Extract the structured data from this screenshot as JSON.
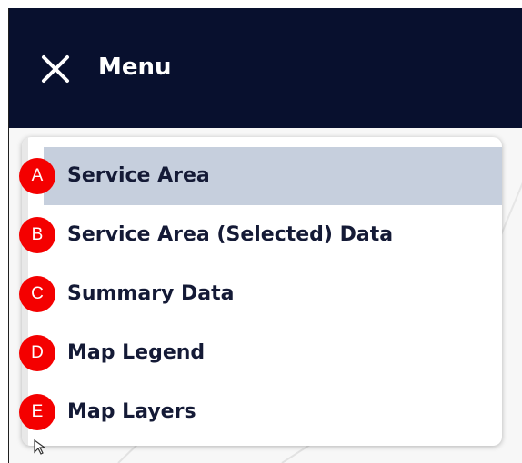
{
  "header": {
    "title": "Menu",
    "close_icon": "close-x-icon",
    "background_color": "#08102e"
  },
  "menu": {
    "items": [
      {
        "label": "Service Area",
        "badge": "A",
        "selected": true
      },
      {
        "label": "Service Area (Selected) Data",
        "badge": "B",
        "selected": false
      },
      {
        "label": "Summary Data",
        "badge": "C",
        "selected": false
      },
      {
        "label": "Map Legend",
        "badge": "D",
        "selected": false
      },
      {
        "label": "Map Layers",
        "badge": "E",
        "selected": false
      }
    ],
    "selected_background": "#c6cfdd",
    "text_color": "#141a36"
  },
  "badges": {
    "color": "#f40000"
  }
}
